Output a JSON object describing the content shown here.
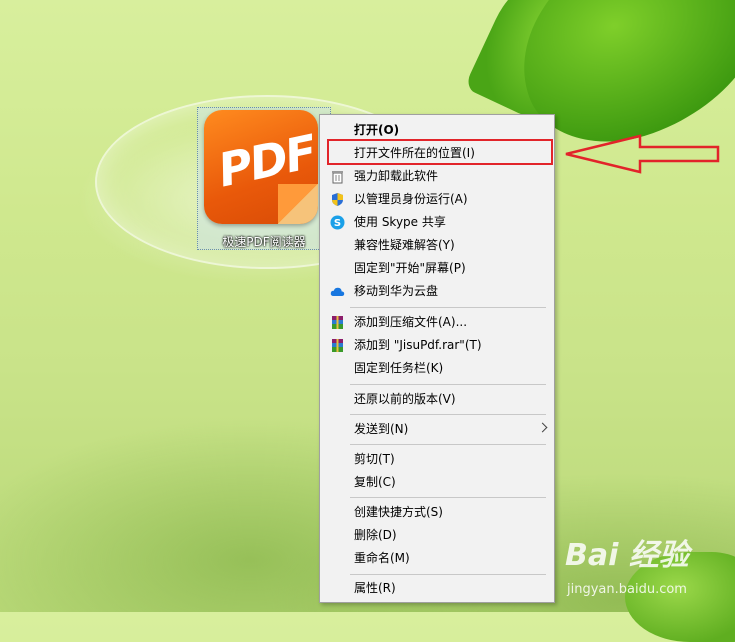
{
  "desktop": {
    "icon_label": "极速PDF阅读器",
    "icon_text": "PDF"
  },
  "menu": {
    "items": [
      {
        "label": "打开(O)",
        "icon": "none"
      },
      {
        "label": "打开文件所在的位置(I)",
        "icon": "none"
      },
      {
        "label": "强力卸载此软件",
        "icon": "trash-icon"
      },
      {
        "label": "以管理员身份运行(A)",
        "icon": "shield-icon"
      },
      {
        "label": "使用 Skype 共享",
        "icon": "skype-icon"
      },
      {
        "label": "兼容性疑难解答(Y)",
        "icon": "none"
      },
      {
        "label": "固定到\"开始\"屏幕(P)",
        "icon": "none"
      },
      {
        "label": "移动到华为云盘",
        "icon": "cloud-icon"
      },
      {
        "label": "添加到压缩文件(A)...",
        "icon": "winrar-icon"
      },
      {
        "label": "添加到 \"JisuPdf.rar\"(T)",
        "icon": "winrar-icon"
      },
      {
        "label": "固定到任务栏(K)",
        "icon": "none"
      },
      {
        "label": "还原以前的版本(V)",
        "icon": "none"
      },
      {
        "label": "发送到(N)",
        "icon": "none"
      },
      {
        "label": "剪切(T)",
        "icon": "none"
      },
      {
        "label": "复制(C)",
        "icon": "none"
      },
      {
        "label": "创建快捷方式(S)",
        "icon": "none"
      },
      {
        "label": "删除(D)",
        "icon": "none"
      },
      {
        "label": "重命名(M)",
        "icon": "none"
      },
      {
        "label": "属性(R)",
        "icon": "none"
      }
    ]
  },
  "watermark": {
    "brand": "Bai 经验",
    "url": "jingyan.baidu.com"
  },
  "colors": {
    "highlight_border": "#e2242a",
    "menu_bg": "#f2f2f2",
    "app_icon": "#e9590a"
  }
}
